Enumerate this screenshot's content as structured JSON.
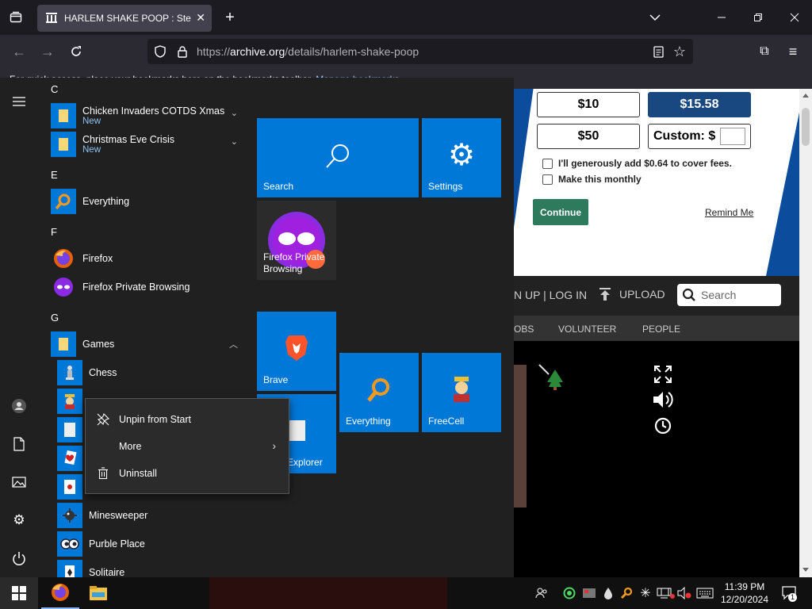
{
  "browser": {
    "tab_title": "HARLEM SHAKE POOP : Steezy",
    "url_prefix": "https://",
    "url_domain": "archive.org",
    "url_path": "/details/harlem-shake-poop",
    "bookmarks_hint": "For quick access, place your bookmarks here on the bookmarks toolbar.",
    "manage_bookmarks": "Manage bookmarks"
  },
  "donate": {
    "amount_1": "$10",
    "amount_2": "$15.58",
    "amount_3": "$50",
    "custom_label": "Custom: $",
    "fee_label": "I'll generously add $0.64 to cover fees.",
    "monthly_label": "Make this monthly",
    "continue": "Continue",
    "remind": "Remind Me"
  },
  "site_nav": {
    "login": "N UP | LOG IN",
    "upload": "UPLOAD",
    "search_placeholder": "Search",
    "sub": [
      "OBS",
      "VOLUNTEER",
      "PEOPLE"
    ]
  },
  "start_menu": {
    "letters": {
      "c": "C",
      "e": "E",
      "f": "F",
      "g": "G"
    },
    "apps": {
      "chicken": {
        "name": "Chicken Invaders COTDS Xmas",
        "badge": "New"
      },
      "christmas": {
        "name": "Christmas Eve Crisis",
        "badge": "New"
      },
      "everything": {
        "name": "Everything"
      },
      "firefox": {
        "name": "Firefox"
      },
      "firefox_private": {
        "name": "Firefox Private Browsing"
      },
      "games": {
        "name": "Games"
      },
      "chess": {
        "name": "Chess"
      },
      "minesweeper": {
        "name": "Minesweeper"
      },
      "purble": {
        "name": "Purble Place"
      },
      "solitaire": {
        "name": "Solitaire"
      }
    },
    "tiles": {
      "search": "Search",
      "settings": "Settings",
      "firefox_private": "Firefox Private Browsing",
      "brave": "Brave",
      "everything": "Everything",
      "freecell": "FreeCell",
      "explorer": "Explorer"
    }
  },
  "context_menu": {
    "unpin": "Unpin from Start",
    "more": "More",
    "uninstall": "Uninstall"
  },
  "taskbar": {
    "time": "11:39 PM",
    "date": "12/20/2024",
    "notification_count": "1"
  },
  "colors": {
    "tile_blue": "#0078d7",
    "selected_amount": "#194880",
    "continue_green": "#2e7a5c"
  }
}
